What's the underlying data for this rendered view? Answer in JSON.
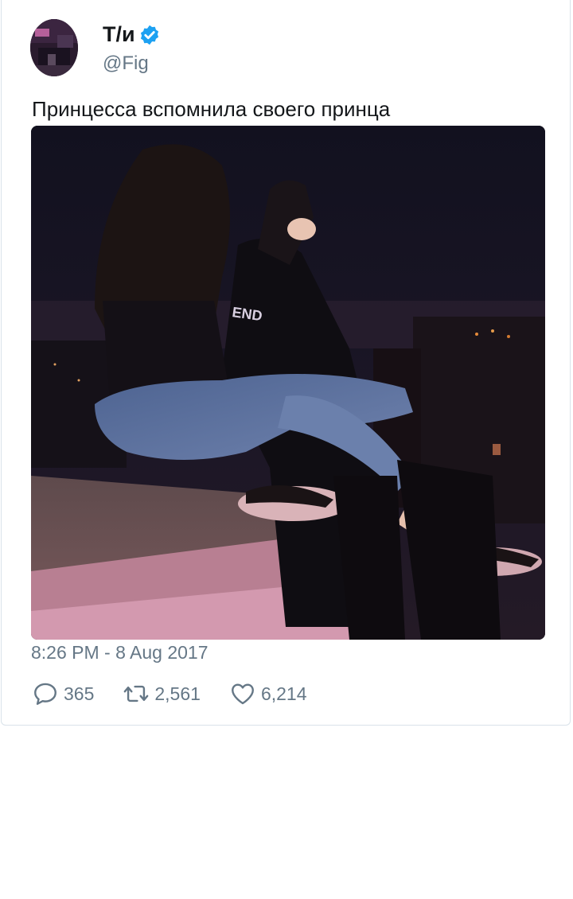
{
  "tweet": {
    "author": {
      "display_name": "Т/и",
      "handle": "@Fig",
      "verified": true,
      "avatar_icon": "user-avatar"
    },
    "text": "Принцесса вспомнила своего принца",
    "media": {
      "icon": "photo-night-rooftop-couple"
    },
    "timestamp": "8:26 PM - 8 Aug 2017",
    "stats": {
      "replies": "365",
      "retweets": "2,561",
      "likes": "6,214"
    }
  },
  "colors": {
    "verified": "#1da1f2",
    "text_primary": "#14171a",
    "text_secondary": "#657786",
    "border": "#d9e2ea"
  }
}
